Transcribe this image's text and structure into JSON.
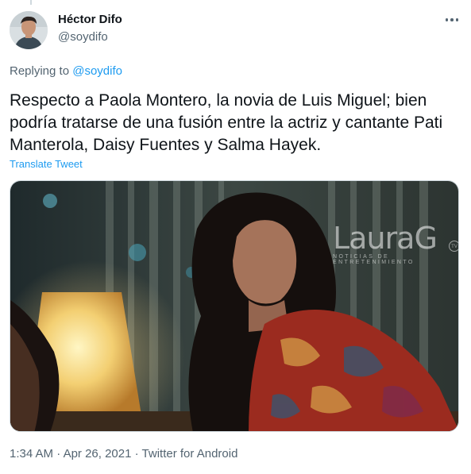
{
  "tweet": {
    "author_name": "Héctor Difo",
    "author_handle": "@soydifo",
    "replying_prefix": "Replying to",
    "replying_to": "@soydifo",
    "text": "Respecto a Paola Montero, la novia de Luis Miguel; bien podría tratarse de una fusión entre la actriz y cantante Pati Manterola, Daisy Fuentes y Salma Hayek.",
    "translate_label": "Translate Tweet",
    "time": "1:34 AM",
    "date": "Apr 26, 2021",
    "source": "Twitter for Android",
    "separator": "·"
  },
  "media": {
    "watermark_main": "LauraG",
    "watermark_tv": "TV",
    "watermark_sub": "NOTICIAS DE ENTRETENIMIENTO"
  },
  "colors": {
    "link": "#1d9bf0",
    "secondary_text": "#536471",
    "primary_text": "#0f1419"
  },
  "icons": {
    "more": "more-horizontal-icon"
  }
}
